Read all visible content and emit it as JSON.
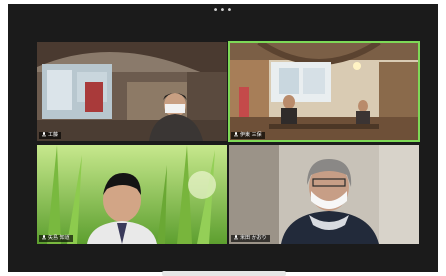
{
  "window": {
    "more_indicator": "•••"
  },
  "tiles": [
    {
      "name": "工藤",
      "speaking": false
    },
    {
      "name": "伊東 三保",
      "speaking": true
    },
    {
      "name": "矢島 知道",
      "speaking": false
    },
    {
      "name": "米田 かおり",
      "speaking": false
    }
  ],
  "icons": {
    "mic": "mic-icon",
    "more": "more-dots-icon"
  },
  "colors": {
    "active_speaker_border": "#7ed957",
    "window_bg": "#1b1b1b"
  }
}
